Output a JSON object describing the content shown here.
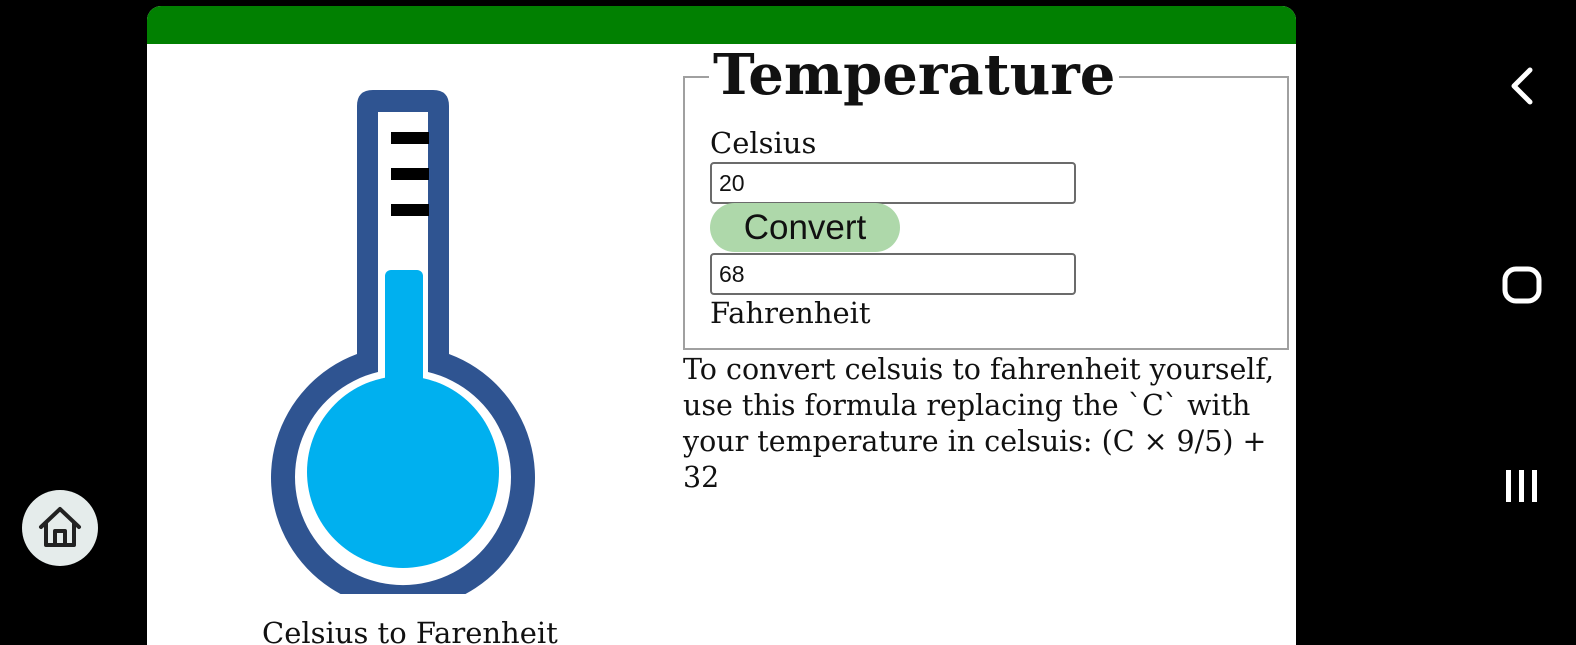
{
  "app": {
    "header_color": "#018001"
  },
  "illustration": {
    "icon": "thermometer-icon",
    "colors": {
      "frame": "#2f5491",
      "fluid": "#00b0ef",
      "ticks": "#000000"
    },
    "caption": "Celsius to Farenheit"
  },
  "converter": {
    "title": "Temperature",
    "celsius_label": "Celsius",
    "celsius_value": "20",
    "convert_label": "Convert",
    "convert_color": "#aed8aa",
    "fahrenheit_value": "68",
    "fahrenheit_label": "Fahrenheit"
  },
  "formula": {
    "text": "To convert celsuis to fahrenheit yourself, use this formula replacing the `C` with your temperature in celsuis: (C × 9/5) + 32"
  },
  "system_nav": {
    "home_icon": "home-icon",
    "back_icon": "back-icon",
    "overview_icon": "home-circle-icon",
    "recents_icon": "recents-icon"
  }
}
